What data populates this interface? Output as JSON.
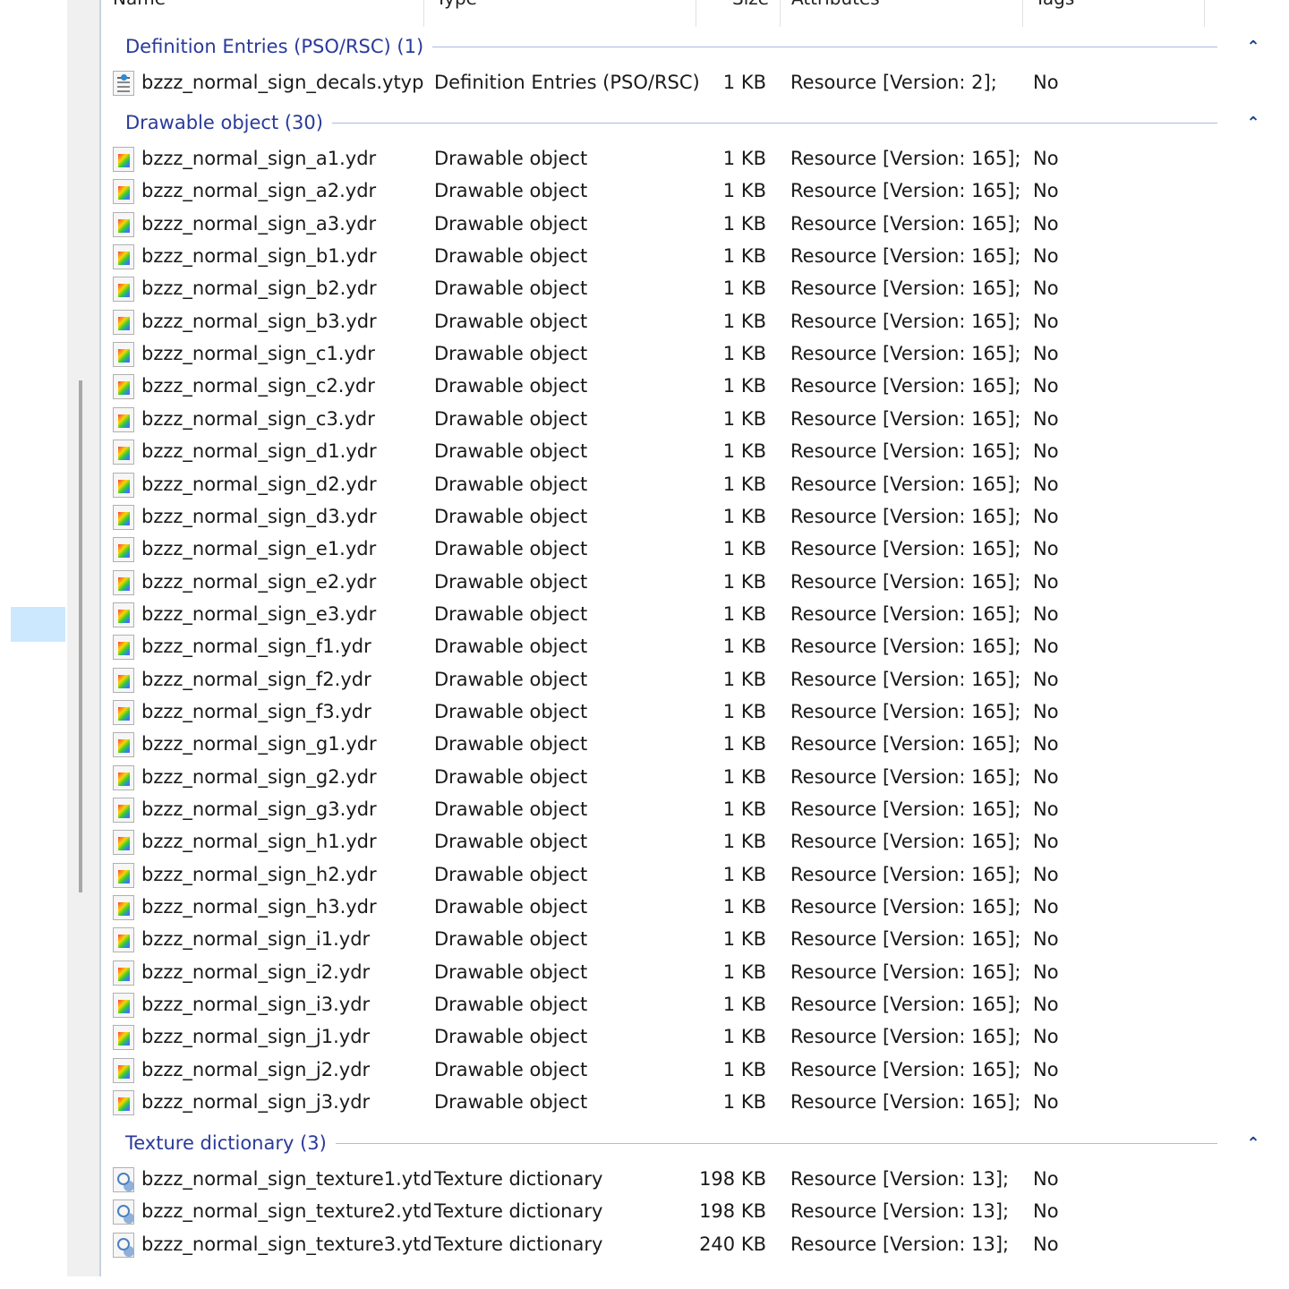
{
  "columns": {
    "name": "Name",
    "type": "Type",
    "size": "Size",
    "attributes": "Attributes",
    "tags": "Tags"
  },
  "groups": [
    {
      "label": "Definition Entries (PSO/RSC) (1)",
      "icon": "ytyp",
      "items": [
        {
          "name": "bzzz_normal_sign_decals.ytyp",
          "type": "Definition Entries (PSO/RSC)",
          "size": "1 KB",
          "attributes": "Resource [Version: 2];",
          "tags": "No"
        }
      ]
    },
    {
      "label": "Drawable object (30)",
      "icon": "ydr",
      "items": [
        {
          "name": "bzzz_normal_sign_a1.ydr",
          "type": "Drawable object",
          "size": "1 KB",
          "attributes": "Resource [Version: 165];",
          "tags": "No"
        },
        {
          "name": "bzzz_normal_sign_a2.ydr",
          "type": "Drawable object",
          "size": "1 KB",
          "attributes": "Resource [Version: 165];",
          "tags": "No"
        },
        {
          "name": "bzzz_normal_sign_a3.ydr",
          "type": "Drawable object",
          "size": "1 KB",
          "attributes": "Resource [Version: 165];",
          "tags": "No"
        },
        {
          "name": "bzzz_normal_sign_b1.ydr",
          "type": "Drawable object",
          "size": "1 KB",
          "attributes": "Resource [Version: 165];",
          "tags": "No"
        },
        {
          "name": "bzzz_normal_sign_b2.ydr",
          "type": "Drawable object",
          "size": "1 KB",
          "attributes": "Resource [Version: 165];",
          "tags": "No"
        },
        {
          "name": "bzzz_normal_sign_b3.ydr",
          "type": "Drawable object",
          "size": "1 KB",
          "attributes": "Resource [Version: 165];",
          "tags": "No"
        },
        {
          "name": "bzzz_normal_sign_c1.ydr",
          "type": "Drawable object",
          "size": "1 KB",
          "attributes": "Resource [Version: 165];",
          "tags": "No"
        },
        {
          "name": "bzzz_normal_sign_c2.ydr",
          "type": "Drawable object",
          "size": "1 KB",
          "attributes": "Resource [Version: 165];",
          "tags": "No"
        },
        {
          "name": "bzzz_normal_sign_c3.ydr",
          "type": "Drawable object",
          "size": "1 KB",
          "attributes": "Resource [Version: 165];",
          "tags": "No"
        },
        {
          "name": "bzzz_normal_sign_d1.ydr",
          "type": "Drawable object",
          "size": "1 KB",
          "attributes": "Resource [Version: 165];",
          "tags": "No"
        },
        {
          "name": "bzzz_normal_sign_d2.ydr",
          "type": "Drawable object",
          "size": "1 KB",
          "attributes": "Resource [Version: 165];",
          "tags": "No"
        },
        {
          "name": "bzzz_normal_sign_d3.ydr",
          "type": "Drawable object",
          "size": "1 KB",
          "attributes": "Resource [Version: 165];",
          "tags": "No"
        },
        {
          "name": "bzzz_normal_sign_e1.ydr",
          "type": "Drawable object",
          "size": "1 KB",
          "attributes": "Resource [Version: 165];",
          "tags": "No"
        },
        {
          "name": "bzzz_normal_sign_e2.ydr",
          "type": "Drawable object",
          "size": "1 KB",
          "attributes": "Resource [Version: 165];",
          "tags": "No"
        },
        {
          "name": "bzzz_normal_sign_e3.ydr",
          "type": "Drawable object",
          "size": "1 KB",
          "attributes": "Resource [Version: 165];",
          "tags": "No"
        },
        {
          "name": "bzzz_normal_sign_f1.ydr",
          "type": "Drawable object",
          "size": "1 KB",
          "attributes": "Resource [Version: 165];",
          "tags": "No"
        },
        {
          "name": "bzzz_normal_sign_f2.ydr",
          "type": "Drawable object",
          "size": "1 KB",
          "attributes": "Resource [Version: 165];",
          "tags": "No"
        },
        {
          "name": "bzzz_normal_sign_f3.ydr",
          "type": "Drawable object",
          "size": "1 KB",
          "attributes": "Resource [Version: 165];",
          "tags": "No"
        },
        {
          "name": "bzzz_normal_sign_g1.ydr",
          "type": "Drawable object",
          "size": "1 KB",
          "attributes": "Resource [Version: 165];",
          "tags": "No"
        },
        {
          "name": "bzzz_normal_sign_g2.ydr",
          "type": "Drawable object",
          "size": "1 KB",
          "attributes": "Resource [Version: 165];",
          "tags": "No"
        },
        {
          "name": "bzzz_normal_sign_g3.ydr",
          "type": "Drawable object",
          "size": "1 KB",
          "attributes": "Resource [Version: 165];",
          "tags": "No"
        },
        {
          "name": "bzzz_normal_sign_h1.ydr",
          "type": "Drawable object",
          "size": "1 KB",
          "attributes": "Resource [Version: 165];",
          "tags": "No"
        },
        {
          "name": "bzzz_normal_sign_h2.ydr",
          "type": "Drawable object",
          "size": "1 KB",
          "attributes": "Resource [Version: 165];",
          "tags": "No"
        },
        {
          "name": "bzzz_normal_sign_h3.ydr",
          "type": "Drawable object",
          "size": "1 KB",
          "attributes": "Resource [Version: 165];",
          "tags": "No"
        },
        {
          "name": "bzzz_normal_sign_i1.ydr",
          "type": "Drawable object",
          "size": "1 KB",
          "attributes": "Resource [Version: 165];",
          "tags": "No"
        },
        {
          "name": "bzzz_normal_sign_i2.ydr",
          "type": "Drawable object",
          "size": "1 KB",
          "attributes": "Resource [Version: 165];",
          "tags": "No"
        },
        {
          "name": "bzzz_normal_sign_i3.ydr",
          "type": "Drawable object",
          "size": "1 KB",
          "attributes": "Resource [Version: 165];",
          "tags": "No"
        },
        {
          "name": "bzzz_normal_sign_j1.ydr",
          "type": "Drawable object",
          "size": "1 KB",
          "attributes": "Resource [Version: 165];",
          "tags": "No"
        },
        {
          "name": "bzzz_normal_sign_j2.ydr",
          "type": "Drawable object",
          "size": "1 KB",
          "attributes": "Resource [Version: 165];",
          "tags": "No"
        },
        {
          "name": "bzzz_normal_sign_j3.ydr",
          "type": "Drawable object",
          "size": "1 KB",
          "attributes": "Resource [Version: 165];",
          "tags": "No"
        }
      ]
    },
    {
      "label": "Texture dictionary (3)",
      "icon": "ytd",
      "items": [
        {
          "name": "bzzz_normal_sign_texture1.ytd",
          "type": "Texture dictionary",
          "size": "198 KB",
          "attributes": "Resource [Version: 13];",
          "tags": "No"
        },
        {
          "name": "bzzz_normal_sign_texture2.ytd",
          "type": "Texture dictionary",
          "size": "198 KB",
          "attributes": "Resource [Version: 13];",
          "tags": "No"
        },
        {
          "name": "bzzz_normal_sign_texture3.ytd",
          "type": "Texture dictionary",
          "size": "240 KB",
          "attributes": "Resource [Version: 13];",
          "tags": "No"
        }
      ]
    }
  ]
}
